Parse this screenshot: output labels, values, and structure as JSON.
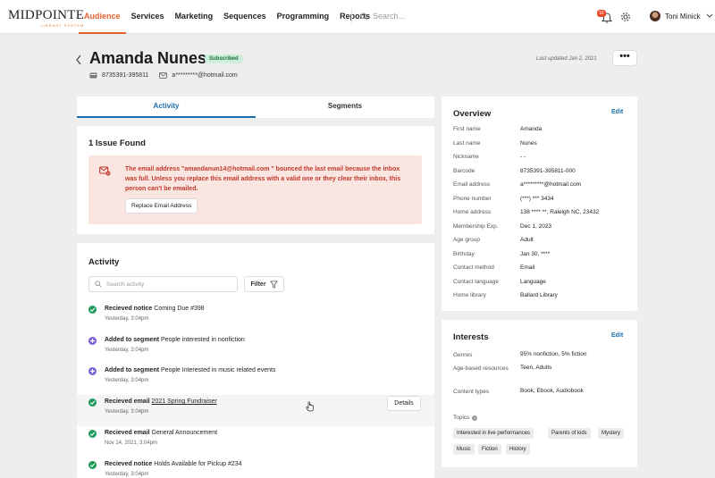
{
  "brand": {
    "logo_text": "MIDPOINTE",
    "logo_sub": "LIBRARY SYSTEM"
  },
  "nav": {
    "items": [
      "Audience",
      "Services",
      "Marketing",
      "Sequences",
      "Programming",
      "Reports"
    ],
    "active": "Audience",
    "search_placeholder": "Search...",
    "notif_count": "10",
    "user_name": "Toni Minick"
  },
  "header": {
    "name": "Amanda Nunes",
    "status_badge": "Subscribed",
    "phone": "8735391-395811",
    "email": "a*********@hotmail.com",
    "last_updated": "Last updated Jan 2, 2021",
    "more_label": "•••"
  },
  "tabs": [
    "Activity",
    "Segments"
  ],
  "issue": {
    "title": "1 Issue Found",
    "message": "The email address \"amandanun14@hotmail.com \" bounced the last email because the inbox was full.  Unless you replace this email address with a valid one or they clear their inbox, this person can't be emailed.",
    "button": "Replace Email Address"
  },
  "activity": {
    "title": "Activity",
    "search_placeholder": "Search activity",
    "filter_label": "Filter",
    "details_label": "Details",
    "items": [
      {
        "action": "Recieved notice",
        "detail": "Coming Due #398",
        "time": "Yesterday, 3:04pm",
        "kind": "check"
      },
      {
        "action": "Added to segment",
        "detail": "People interested in nonfiction",
        "time": "Yesterday, 3:04pm",
        "kind": "plus"
      },
      {
        "action": "Added to segment",
        "detail": "People Interested in music related events",
        "time": "Yesterday, 3:04pm",
        "kind": "plus"
      },
      {
        "action": "Recieved email",
        "detail": "2021 Spring Fundraiser",
        "time": "Yesterday, 3:04pm",
        "kind": "check"
      },
      {
        "action": "Recieved email",
        "detail": "General Announcement",
        "time": "Nov 14, 2021, 3:04pm",
        "kind": "check"
      },
      {
        "action": "Recieved notice",
        "detail": "Holds Available for Pickup #234",
        "time": "Yesterday, 3:04pm",
        "kind": "check"
      }
    ]
  },
  "overview": {
    "title": "Overview",
    "edit": "Edit",
    "rows": [
      {
        "label": "First name",
        "value": "Amanda"
      },
      {
        "label": "Last name",
        "value": "Nunes"
      },
      {
        "label": "Nickname",
        "value": "- -"
      },
      {
        "label": "Barcode",
        "value": "8735391-395811-000"
      },
      {
        "label": "Email address",
        "value": "a*********@hotmail.com"
      },
      {
        "label": "Phone number",
        "value": "(***) *** 3434"
      },
      {
        "label": "Home address",
        "value": "138 **** **, Raleigh NC, 23432"
      },
      {
        "label": "Membership Exp.",
        "value": "Dec 1, 2023"
      },
      {
        "label": "Age group",
        "value": "Adult"
      },
      {
        "label": "Birthday",
        "value": "Jan 30, ****"
      },
      {
        "label": "Contact method",
        "value": "Email"
      },
      {
        "label": "Contact language",
        "value": "Language"
      },
      {
        "label": "Home library",
        "value": "Ballard Library"
      }
    ]
  },
  "interests": {
    "title": "Interests",
    "edit": "Edit",
    "rows": [
      {
        "label": "Genres",
        "value": "95% nonfiction, 5% fiction"
      },
      {
        "label": "Age-based resources",
        "value": "Teen, Adults"
      },
      {
        "label": "Content types",
        "value": "Book, Ebook, Audiobook"
      }
    ],
    "topics_label": "Topics",
    "topics": [
      "Interested in live performances",
      "Parents of kids",
      "Mystery",
      "Music",
      "Fiction",
      "History"
    ]
  },
  "colors": {
    "accent": "#e0612e",
    "link": "#1a6fae",
    "success": "#1e9a5b",
    "segment": "#7b5fd6",
    "error_bg": "#fbe5e1",
    "error_text": "#c0392b"
  }
}
